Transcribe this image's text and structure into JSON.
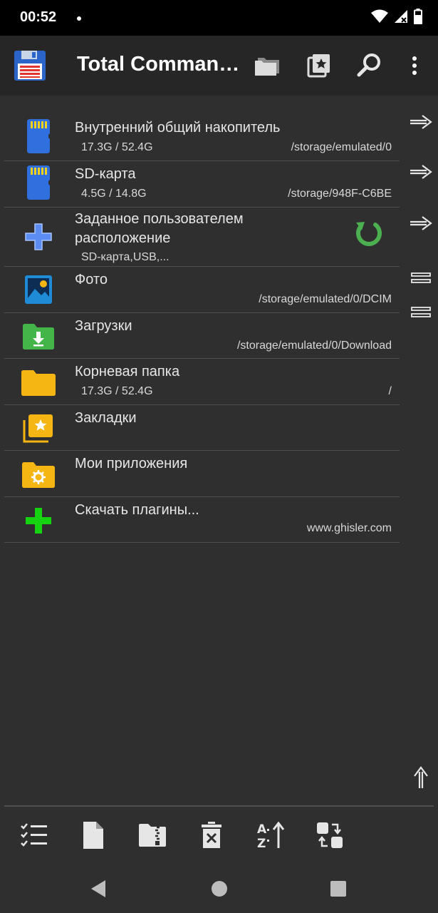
{
  "status_bar": {
    "time": "00:52",
    "icons": [
      "wifi-icon",
      "signal-icon",
      "battery-icon"
    ]
  },
  "app_bar": {
    "title": "Total Comman…",
    "actions": [
      "folders-icon",
      "bookmarks-icon",
      "search-icon",
      "more-icon"
    ]
  },
  "locations": [
    {
      "title": "Внутренний общий накопитель",
      "size": "17.3G / 52.4G",
      "path": "/storage/emulated/0",
      "icon": "sd-card-icon"
    },
    {
      "title": "SD-карта",
      "size": "4.5G / 14.8G",
      "path": "/storage/948F-C6BE",
      "icon": "sd-card-icon"
    },
    {
      "title_line1": "Заданное пользователем",
      "title_line2": "расположение",
      "size": "SD-карта,USB,...",
      "icon": "plus-icon",
      "action_icon": "refresh-icon"
    },
    {
      "title": "Фото",
      "path": "/storage/emulated/0/DCIM",
      "icon": "photo-icon"
    },
    {
      "title": "Загрузки",
      "path": "/storage/emulated/0/Download",
      "icon": "download-folder-icon"
    },
    {
      "title": "Корневая папка",
      "size": "17.3G / 52.4G",
      "path": "/",
      "icon": "folder-icon"
    },
    {
      "title": "Закладки",
      "icon": "bookmark-folder-icon"
    },
    {
      "title": "Мои приложения",
      "icon": "apps-folder-icon"
    },
    {
      "title": "Скачать плагины...",
      "path": "www.ghisler.com",
      "icon": "green-plus-icon"
    }
  ],
  "side_buttons": [
    "arrow-right-icon",
    "arrow-right-icon",
    "arrow-right-icon",
    "equals-icon",
    "equals-icon",
    "arrow-up-icon"
  ],
  "toolbar": [
    "select-icon",
    "new-file-icon",
    "zip-icon",
    "delete-icon",
    "sort-icon",
    "swap-icon"
  ],
  "nav": [
    "back-icon",
    "home-icon",
    "recents-icon"
  ],
  "colors": {
    "background": "#2f2f2f",
    "app_bar": "#262626",
    "status_bar": "#000000",
    "divider": "#4f4f4f",
    "folder_yellow": "#f5b512",
    "sd_blue": "#2f6fde",
    "refresh_green": "#4caf50",
    "plugin_green": "#16d30f"
  }
}
